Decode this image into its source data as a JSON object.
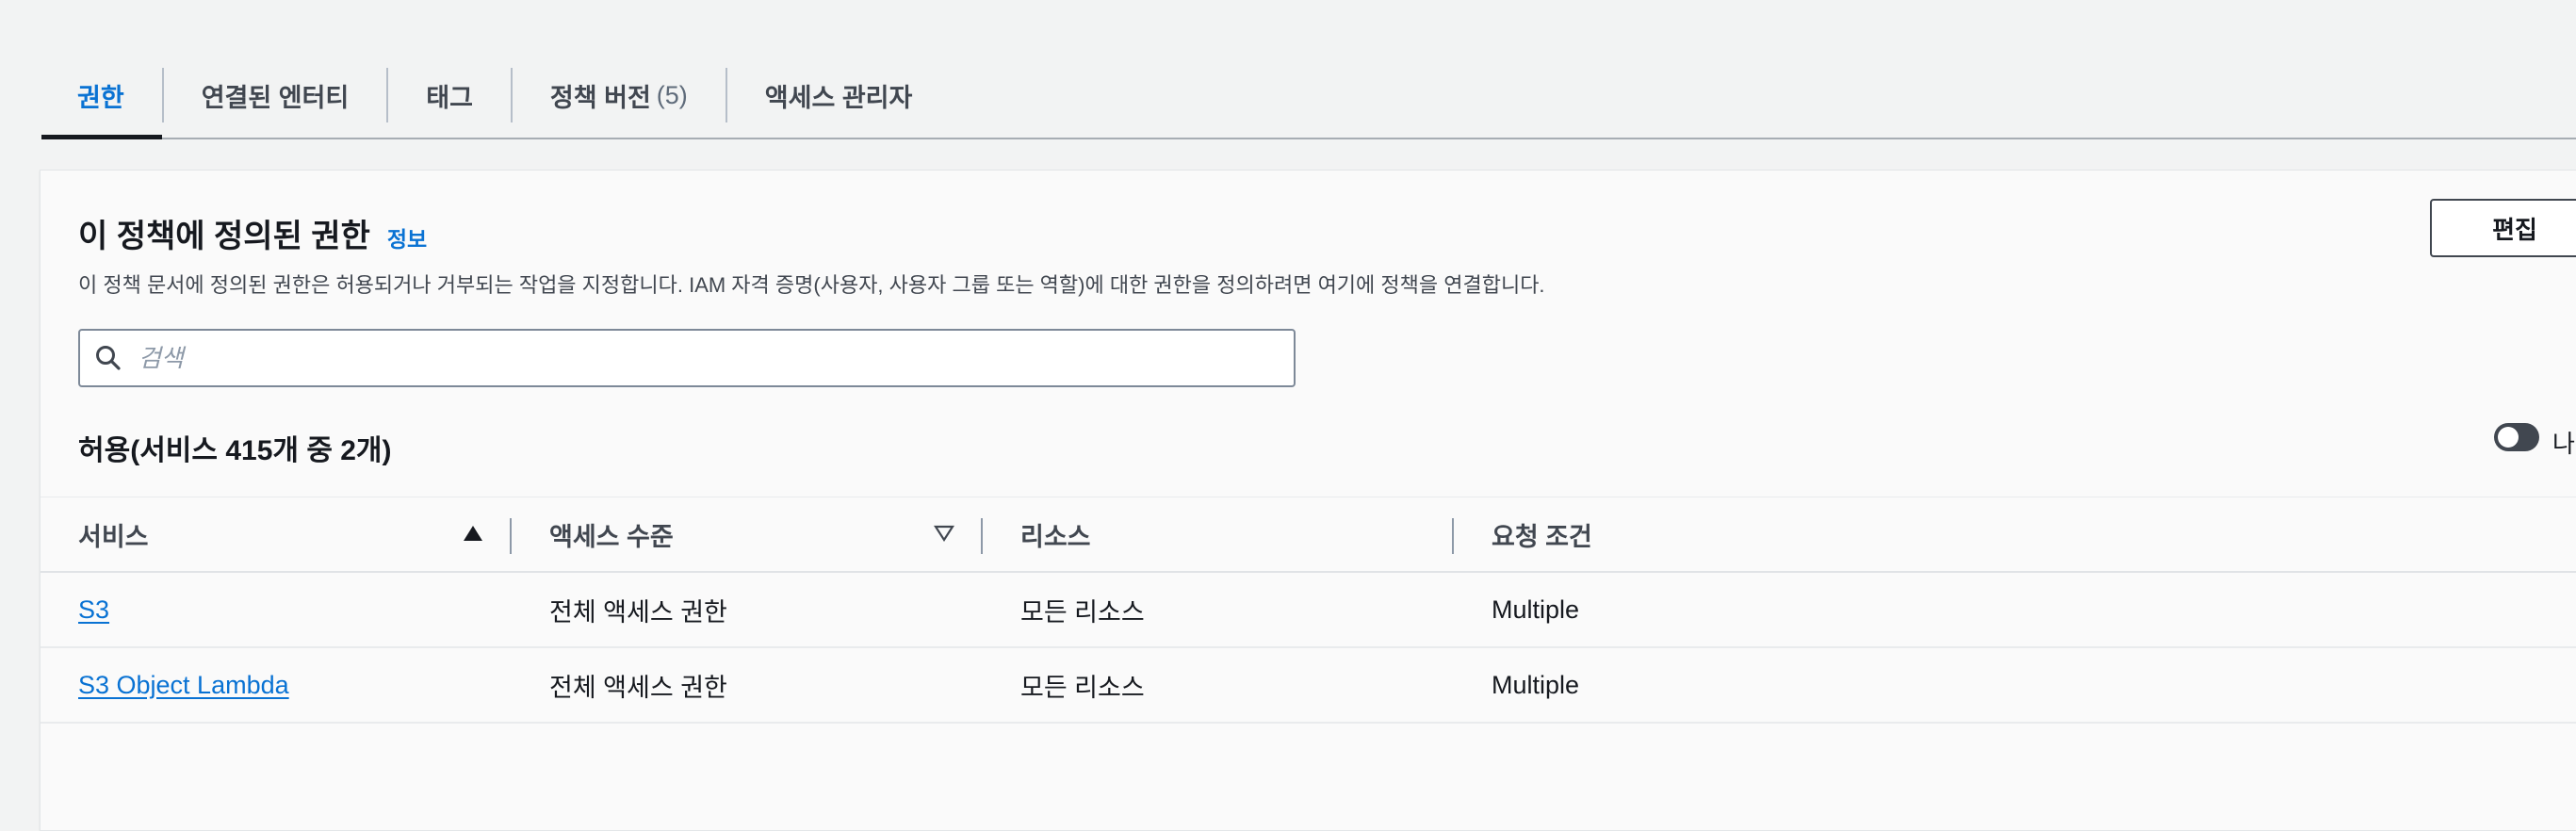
{
  "tabs": [
    {
      "label": "권한",
      "active": true
    },
    {
      "label": "연결된 엔터티"
    },
    {
      "label": "태그"
    },
    {
      "label": "정책 버전",
      "count": "(5)"
    },
    {
      "label": "액세스 관리자"
    }
  ],
  "panel": {
    "title": "이 정책에 정의된 권한",
    "info_link": "정보",
    "description": "이 정책 문서에 정의된 권한은 허용되거나 거부되는 작업을 지정합니다. IAM 자격 증명(사용자, 사용자 그룹 또는 역할)에 대한 권한을 정의하려면 여기에 정책을 연결합니다.",
    "edit_button": "편집",
    "search_placeholder": "검색",
    "allow_heading": "허용(서비스 415개 중 2개)",
    "toggle_label": "나"
  },
  "table": {
    "columns": [
      "서비스",
      "액세스 수준",
      "리소스",
      "요청 조건"
    ],
    "rows": [
      {
        "service": "S3",
        "access": "전체 액세스 권한",
        "resource": "모든 리소스",
        "condition": "Multiple"
      },
      {
        "service": "S3 Object Lambda",
        "access": "전체 액세스 권한",
        "resource": "모든 리소스",
        "condition": "Multiple"
      }
    ]
  },
  "colors": {
    "link": "#0972d3",
    "text": "#16191f",
    "background": "#f2f3f3"
  }
}
